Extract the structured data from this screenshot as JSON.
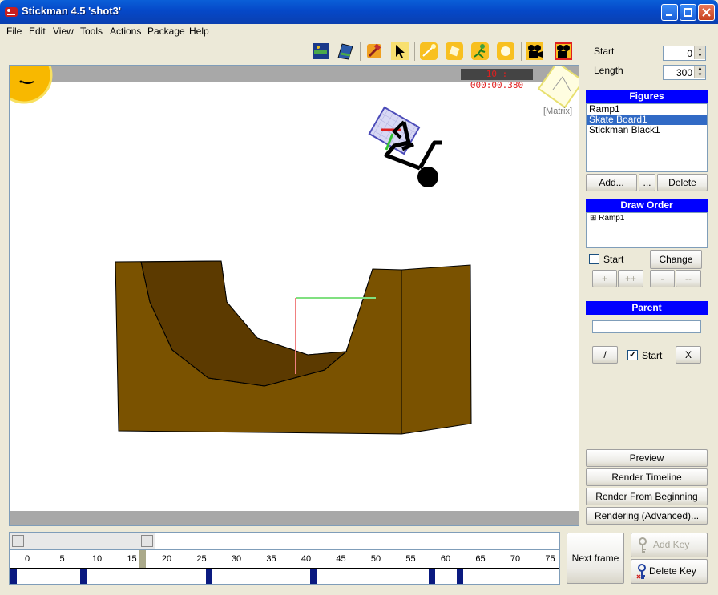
{
  "window": {
    "title": "Stickman 4.5 'shot3'"
  },
  "menu": {
    "items": [
      "File",
      "Edit",
      "View",
      "Tools",
      "Actions",
      "Package",
      "Help"
    ]
  },
  "toolbar": {
    "icons": [
      "figure-library-icon",
      "package-icon",
      "hammer-icon",
      "pointer-icon",
      "light-move-icon",
      "rotate-icon",
      "stickman-pose-icon",
      "light-bulb-icon",
      "camera-icon",
      "camera-record-icon"
    ]
  },
  "canvas": {
    "time_readout": "10 : 000:00.380",
    "matrix_label": "[Matrix]"
  },
  "settings": {
    "start_label": "Start",
    "start_value": "0",
    "length_label": "Length",
    "length_value": "300"
  },
  "figures": {
    "header": "Figures",
    "items": [
      "Ramp1",
      "Skate Board1",
      "Stickman Black1"
    ],
    "selected_index": 1,
    "add_button": "Add...",
    "more_button": "...",
    "delete_button": "Delete"
  },
  "draw_order": {
    "header": "Draw Order",
    "items": [
      "Ramp1"
    ],
    "expander": "⊞",
    "start_label": "Start",
    "start_checked": false,
    "change_button": "Change",
    "plus_button": "+",
    "plusplus_button": "++",
    "minus_button": "-",
    "minusminus_button": "--"
  },
  "parent": {
    "header": "Parent",
    "field_value": "",
    "slash_button": "/",
    "start_label": "Start",
    "start_checked": true,
    "clear_button": "X"
  },
  "render": {
    "preview_button": "Preview",
    "render_timeline_button": "Render Timeline",
    "render_from_beginning_button": "Render From Beginning",
    "rendering_advanced_button": "Rendering (Advanced)..."
  },
  "timeline": {
    "ticks": [
      "0",
      "5",
      "10",
      "15",
      "20",
      "25",
      "30",
      "35",
      "40",
      "45",
      "50",
      "55",
      "60",
      "65",
      "70",
      "75"
    ],
    "key_frames": [
      0,
      10,
      28,
      43,
      60,
      64
    ],
    "current_frame": 19
  },
  "keys": {
    "next_frame_button": "Next frame",
    "add_key_button": "Add Key",
    "delete_key_button": "Delete Key"
  },
  "colors": {
    "ramp_front": "#7a5200",
    "ramp_inner": "#5c3a00",
    "section_head": "#0000ff",
    "selection": "#316ac5",
    "key_marker": "#0a1a80"
  }
}
